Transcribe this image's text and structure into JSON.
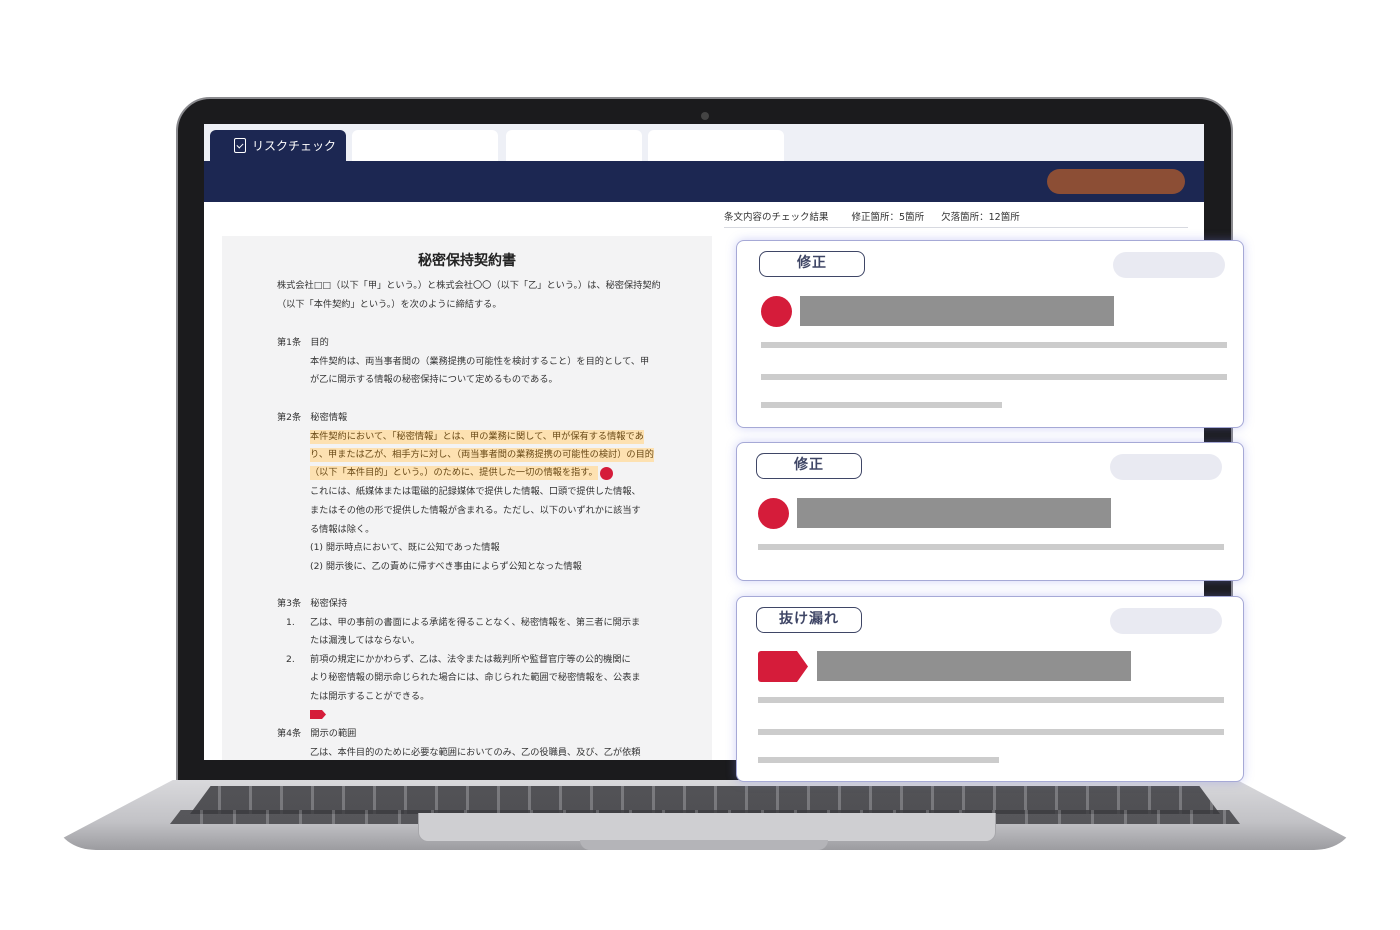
{
  "tabs": [
    {
      "label": "リスクチェック",
      "icon": "document-check-icon",
      "active": true
    },
    {
      "label": "",
      "active": false
    },
    {
      "label": "",
      "active": false
    },
    {
      "label": "",
      "active": false
    }
  ],
  "summary": {
    "label": "条文内容のチェック結果",
    "fix_count": "修正箇所：5箇所",
    "missing_count": "欠落箇所：12箇所"
  },
  "document": {
    "title": "秘密保持契約書",
    "intro": [
      "株式会社□□（以下「甲」という。）と株式会社〇〇（以下「乙」という。）は、秘密保持契約",
      "（以下「本件契約」という。）を次のように締結する。"
    ],
    "article1": {
      "heading": "第1条　目的",
      "lines": [
        "本件契約は、両当事者間の（業務提携の可能性を検討すること）を目的として、甲",
        "が乙に開示する情報の秘密保持について定めるものである。"
      ]
    },
    "article2": {
      "heading": "第2条　秘密情報",
      "highlighted": [
        "本件契約において、「秘密情報」とは、甲の業務に関して、甲が保有する情報であ",
        "り、甲または乙が、相手方に対し、（両当事者間の業務提携の可能性の検討）の目的",
        "（以下「本件目的」という。）のために、提供した一切の情報を指す。"
      ],
      "lines": [
        "これには、紙媒体または電磁的記録媒体で提供した情報、口頭で提供した情報、",
        "またはその他の形で提供した情報が含まれる。ただし、以下のいずれかに該当す",
        "る情報は除く。",
        "(1) 開示時点において、既に公知であった情報",
        "(2) 開示後に、乙の責めに帰すべき事由によらず公知となった情報"
      ]
    },
    "article3": {
      "heading": "第3条　秘密保持",
      "items": [
        {
          "num": "1.",
          "lines": [
            "乙は、甲の事前の書面による承諾を得ることなく、秘密情報を、第三者に開示ま",
            "たは漏洩してはならない。"
          ]
        },
        {
          "num": "2.",
          "lines": [
            "前項の規定にかかわらず、乙は、法令または裁判所や監督官庁等の公的機関に",
            "より秘密情報の開示命じられた場合には、命じられた範囲で秘密情報を、公表ま",
            "たは開示することができる。"
          ]
        }
      ]
    },
    "article4": {
      "heading": "第4条　開示の範囲",
      "lines": [
        "乙は、本件目的のために必要な範囲においてのみ、乙の役職員、及び、乙が依頼"
      ]
    }
  },
  "cards": [
    {
      "badge": "修正",
      "marker": "red-dot-icon"
    },
    {
      "badge": "修正",
      "marker": "red-dot-icon"
    },
    {
      "badge": "抜け漏れ",
      "marker": "red-tag-icon"
    }
  ],
  "colors": {
    "navy": "#1c2752",
    "accent_button": "#8c4e35",
    "marker_red": "#d51c3a",
    "highlight": "#fde1b1"
  }
}
